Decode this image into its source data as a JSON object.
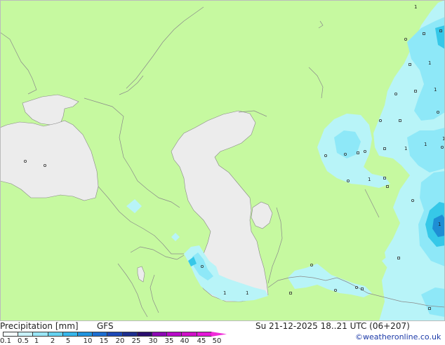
{
  "title": "Precipitation [mm]",
  "model": "GFS",
  "timestamp": "Su 21-12-2025 18..21 UTC (06+207)",
  "credit": "©weatheronline.co.uk",
  "colors": {
    "land": "#c6f9a0",
    "water": "#ececec",
    "precip_light": "#b8f4f8",
    "precip_mid": "#8ee8f8",
    "precip_strong": "#36c8e8",
    "precip_heavy": "#1e8ed4",
    "coast": "#888888"
  },
  "legend": {
    "ticks": [
      "0.1",
      "0.5",
      "1",
      "2",
      "5",
      "10",
      "15",
      "20",
      "25",
      "30",
      "35",
      "40",
      "45",
      "50"
    ],
    "swatches": [
      "#f4fcfe",
      "#c8f2fa",
      "#9ae6f6",
      "#64d2f0",
      "#36b6ea",
      "#2094de",
      "#1c6ed0",
      "#1c48b6",
      "#1c2e8e",
      "#2a0e6e",
      "#8c08b4",
      "#b80ac8",
      "#d010c8",
      "#e418d8",
      "#f02cd8"
    ]
  },
  "value_labels": [
    {
      "text": "1",
      "kind": "number"
    },
    {
      "text": "1",
      "kind": "number"
    },
    {
      "text": "1",
      "kind": "number"
    },
    {
      "text": "1",
      "kind": "number"
    },
    {
      "text": "1",
      "kind": "number"
    },
    {
      "text": "1",
      "kind": "number"
    },
    {
      "text": "1",
      "kind": "number"
    },
    {
      "text": "1",
      "kind": "number"
    },
    {
      "text": "1",
      "kind": "number"
    },
    {
      "text": "1",
      "kind": "number"
    }
  ]
}
